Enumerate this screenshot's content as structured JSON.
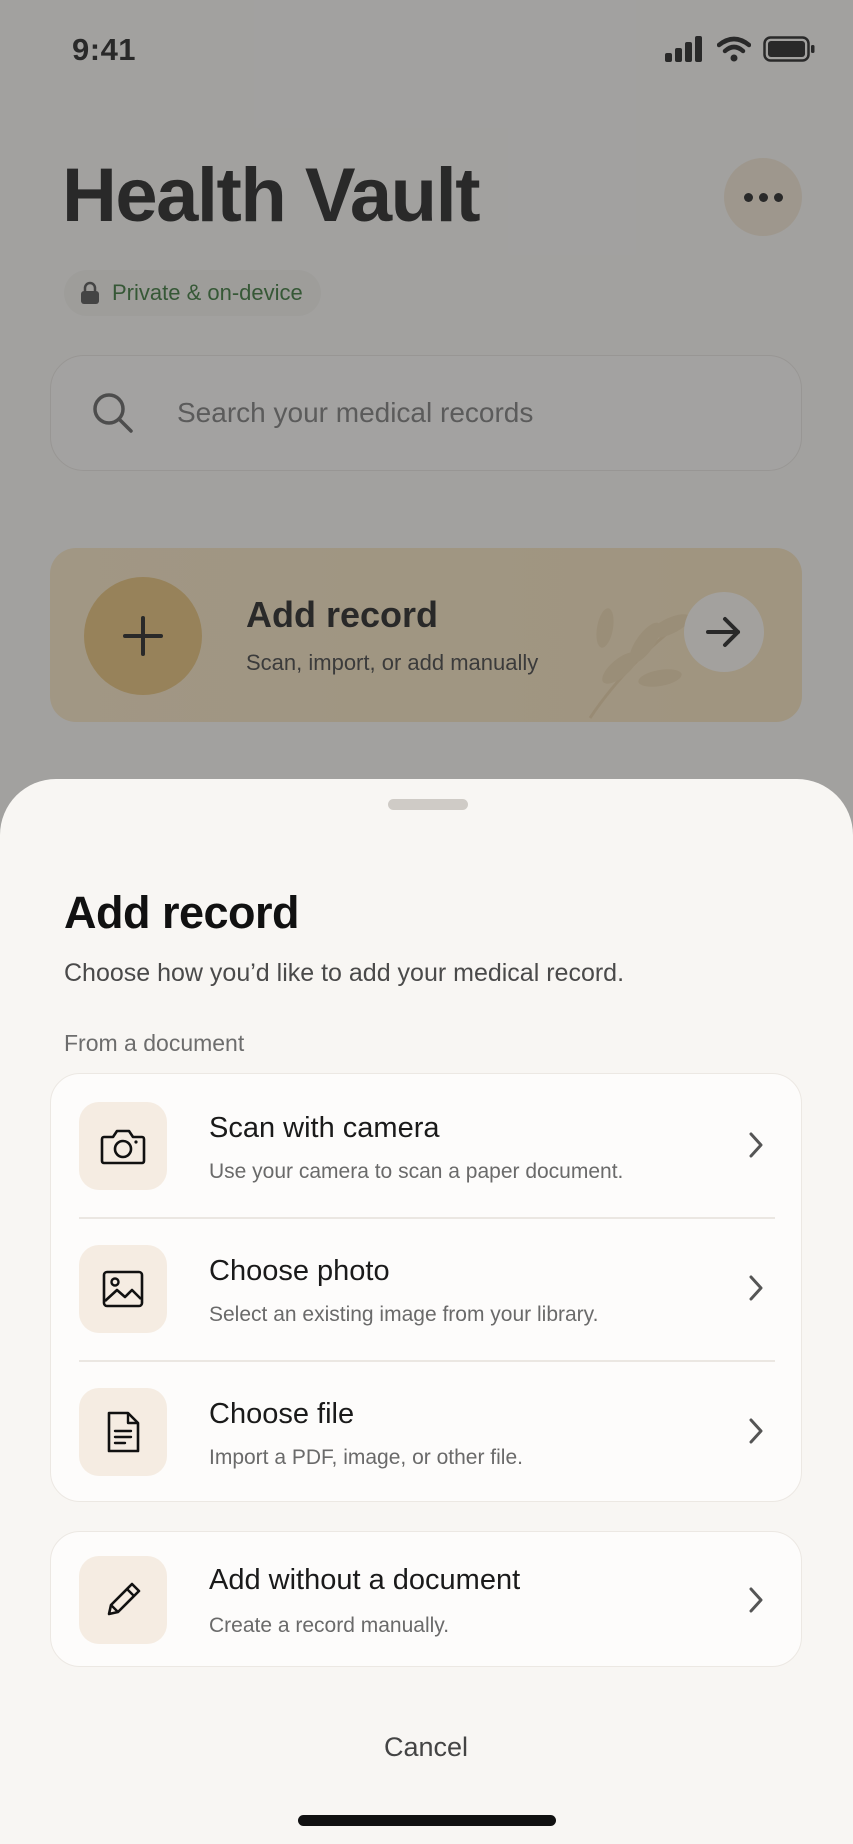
{
  "status_bar": {
    "time": "9:41"
  },
  "header": {
    "title": "Health Vault",
    "privacy_label": "Private & on-device"
  },
  "search": {
    "placeholder": "Search your medical records"
  },
  "add_card": {
    "title": "Add record",
    "subtitle": "Scan, import, or add manually"
  },
  "sheet": {
    "title": "Add record",
    "subtitle": "Choose how you’d like to add your medical record.",
    "section_label": "From a document",
    "options": [
      {
        "title": "Scan with camera",
        "subtitle": "Use your camera to scan a paper document.",
        "icon": "camera-icon"
      },
      {
        "title": "Choose photo",
        "subtitle": "Select an existing image from your library.",
        "icon": "image-icon"
      },
      {
        "title": "Choose file",
        "subtitle": "Import a PDF, image, or other file.",
        "icon": "document-icon"
      }
    ],
    "manual_option": {
      "title": "Add without a document",
      "subtitle": "Create a record manually.",
      "icon": "pencil-icon"
    },
    "cancel_label": "Cancel"
  },
  "colors": {
    "accent": "#e2bb6d",
    "card_background": "#f5e2bf",
    "privacy_text": "#2a6a2a",
    "sheet_background": "#f8f6f3",
    "icon_tile": "#f5ece2"
  }
}
